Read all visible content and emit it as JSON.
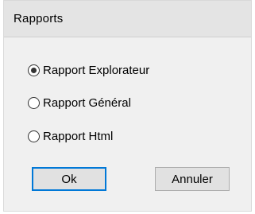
{
  "dialog": {
    "title": "Rapports"
  },
  "options": [
    {
      "label": "Rapport Explorateur",
      "checked": true
    },
    {
      "label": "Rapport Général",
      "checked": false
    },
    {
      "label": "Rapport Html",
      "checked": false
    }
  ],
  "buttons": {
    "ok_label": "Ok",
    "cancel_label": "Annuler"
  },
  "colors": {
    "dialog_bg": "#f0f0f0",
    "title_bg": "#e4e4e4",
    "default_button_border": "#0078d7"
  }
}
